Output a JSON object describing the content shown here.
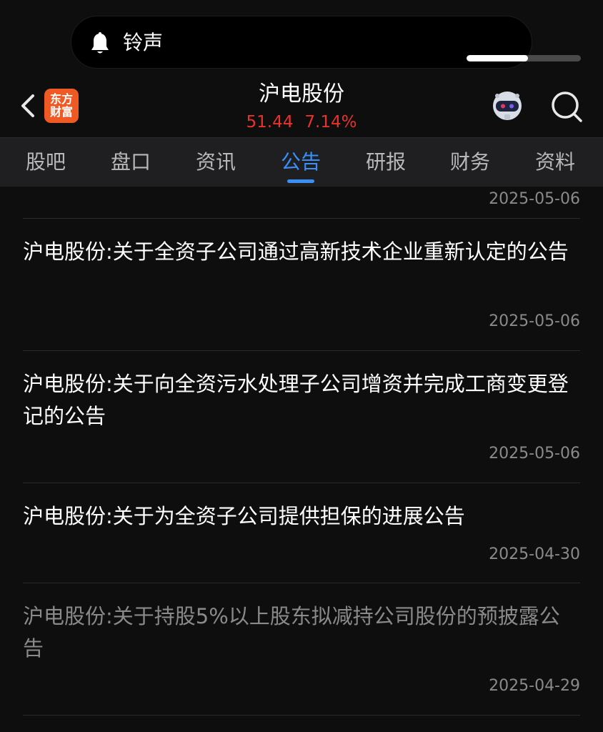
{
  "ringer": {
    "label": "铃声",
    "volume_fraction": 0.54
  },
  "header": {
    "logo_lines": [
      "东方",
      "财富"
    ],
    "stock_name": "沪电股份",
    "price": "51.44",
    "change_pct": "7.14%",
    "quote_color": "#e8322b"
  },
  "tabs": [
    {
      "label": "股吧"
    },
    {
      "label": "盘口"
    },
    {
      "label": "资讯"
    },
    {
      "label": "公告",
      "active": true
    },
    {
      "label": "研报"
    },
    {
      "label": "财务"
    },
    {
      "label": "资料"
    }
  ],
  "announcements": [
    {
      "title": "",
      "date": "2025-05-06"
    },
    {
      "title": "沪电股份:关于全资子公司通过高新技术企业重新认定的公告",
      "date": "2025-05-06"
    },
    {
      "title": "沪电股份:关于向全资污水处理子公司增资并完成工商变更登记的公告",
      "date": "2025-05-06"
    },
    {
      "title": "沪电股份:关于为全资子公司提供担保的进展公告",
      "date": "2025-04-30"
    },
    {
      "title": "沪电股份:关于持股5%以上股东拟减持公司股份的预披露公告",
      "date": "2025-04-29",
      "read": true
    }
  ],
  "colors": {
    "accent": "#3a8ff6",
    "background": "#0e0e0e",
    "tab_bar": "#1f1f21",
    "brand": "#ef5a24"
  }
}
